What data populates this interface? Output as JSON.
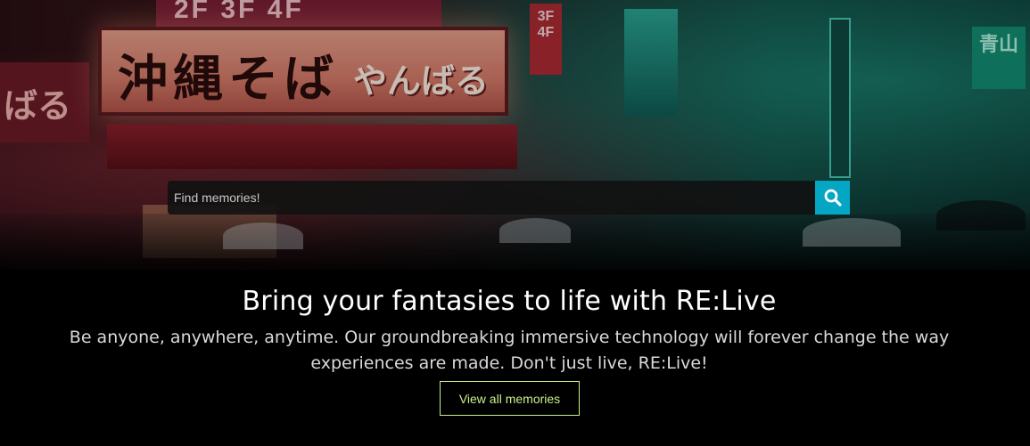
{
  "hero": {
    "signs": {
      "main": "沖縄そば",
      "sub": "やんばる",
      "top": "2F 3F 4F",
      "left": "ばる",
      "floors": "3F 4F",
      "right": "青山"
    }
  },
  "search": {
    "placeholder": "Find memories!",
    "value": "",
    "button_icon": "search-icon",
    "button_color": "#05a6c4"
  },
  "content": {
    "headline": "Bring your fantasies to life with RE:Live",
    "tagline": "Be anyone, anywhere, anytime. Our groundbreaking immersive technology will forever change the way experiences are made. Don't just live, RE:Live!",
    "view_all_label": "View all memories",
    "accent_color": "#c8f08c"
  }
}
